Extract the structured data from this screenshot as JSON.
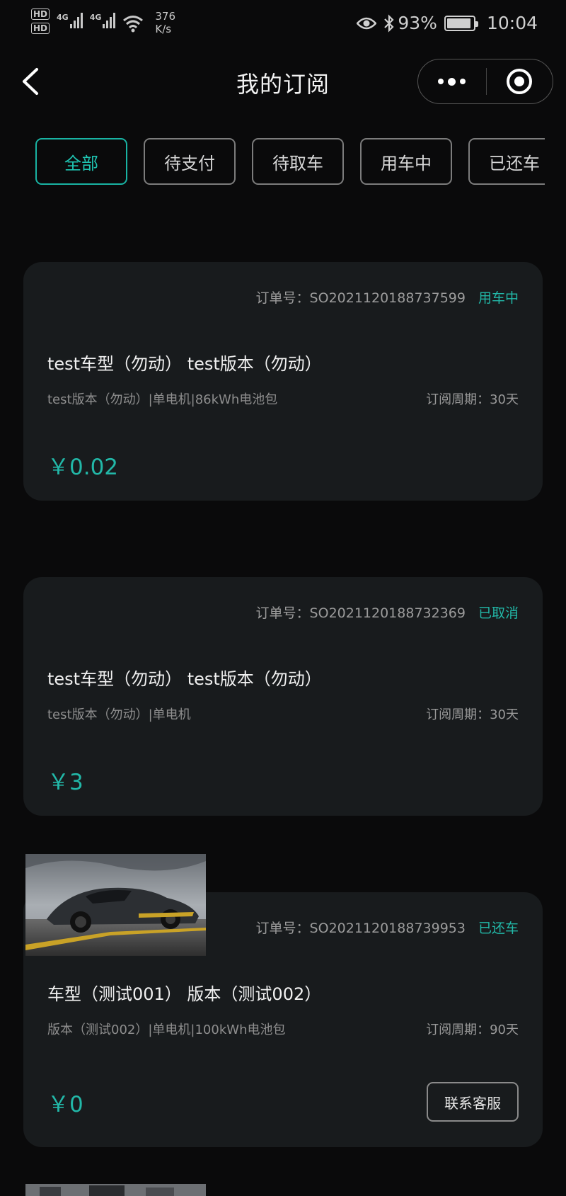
{
  "status_bar": {
    "hd1": "HD",
    "hd2": "HD",
    "net1": "4G",
    "net2": "4G",
    "speed_value": "376",
    "speed_unit": "K/s",
    "battery": "93%",
    "battery_level": 0.93,
    "time": "10:04"
  },
  "nav": {
    "title": "我的订阅",
    "icons": [
      "back-arrow-icon",
      "more-dots-icon",
      "target-circle-icon"
    ]
  },
  "tabs": [
    {
      "label": "全部",
      "active": true
    },
    {
      "label": "待支付",
      "active": false
    },
    {
      "label": "待取车",
      "active": false
    },
    {
      "label": "用车中",
      "active": false
    },
    {
      "label": "已还车",
      "active": false
    }
  ],
  "orders": [
    {
      "order_no": "订单号：SO2021120188737599",
      "status": "用车中",
      "car_name": "test车型（勿动） test版本（勿动）",
      "spec": "test版本（勿动）|单电机|86kWh电池包",
      "period": "订阅周期：30天",
      "price": "￥0.02"
    },
    {
      "order_no": "订单号：SO2021120188732369",
      "status": "已取消",
      "car_name": "test车型（勿动） test版本（勿动）",
      "spec": "test版本（勿动）|单电机",
      "period": "订阅周期：30天",
      "price": "￥3"
    },
    {
      "order_no": "订单号：SO2021120188739953",
      "status": "已还车",
      "car_name": "车型（测试001） 版本（测试002）",
      "spec": "版本（测试002）|单电机|100kWh电池包",
      "period": "订阅周期：90天",
      "price": "￥0",
      "action": "联系客服"
    }
  ],
  "colors": {
    "accent": "#22b8a8",
    "background": "#0a0a0b",
    "card": "#181b1d"
  }
}
